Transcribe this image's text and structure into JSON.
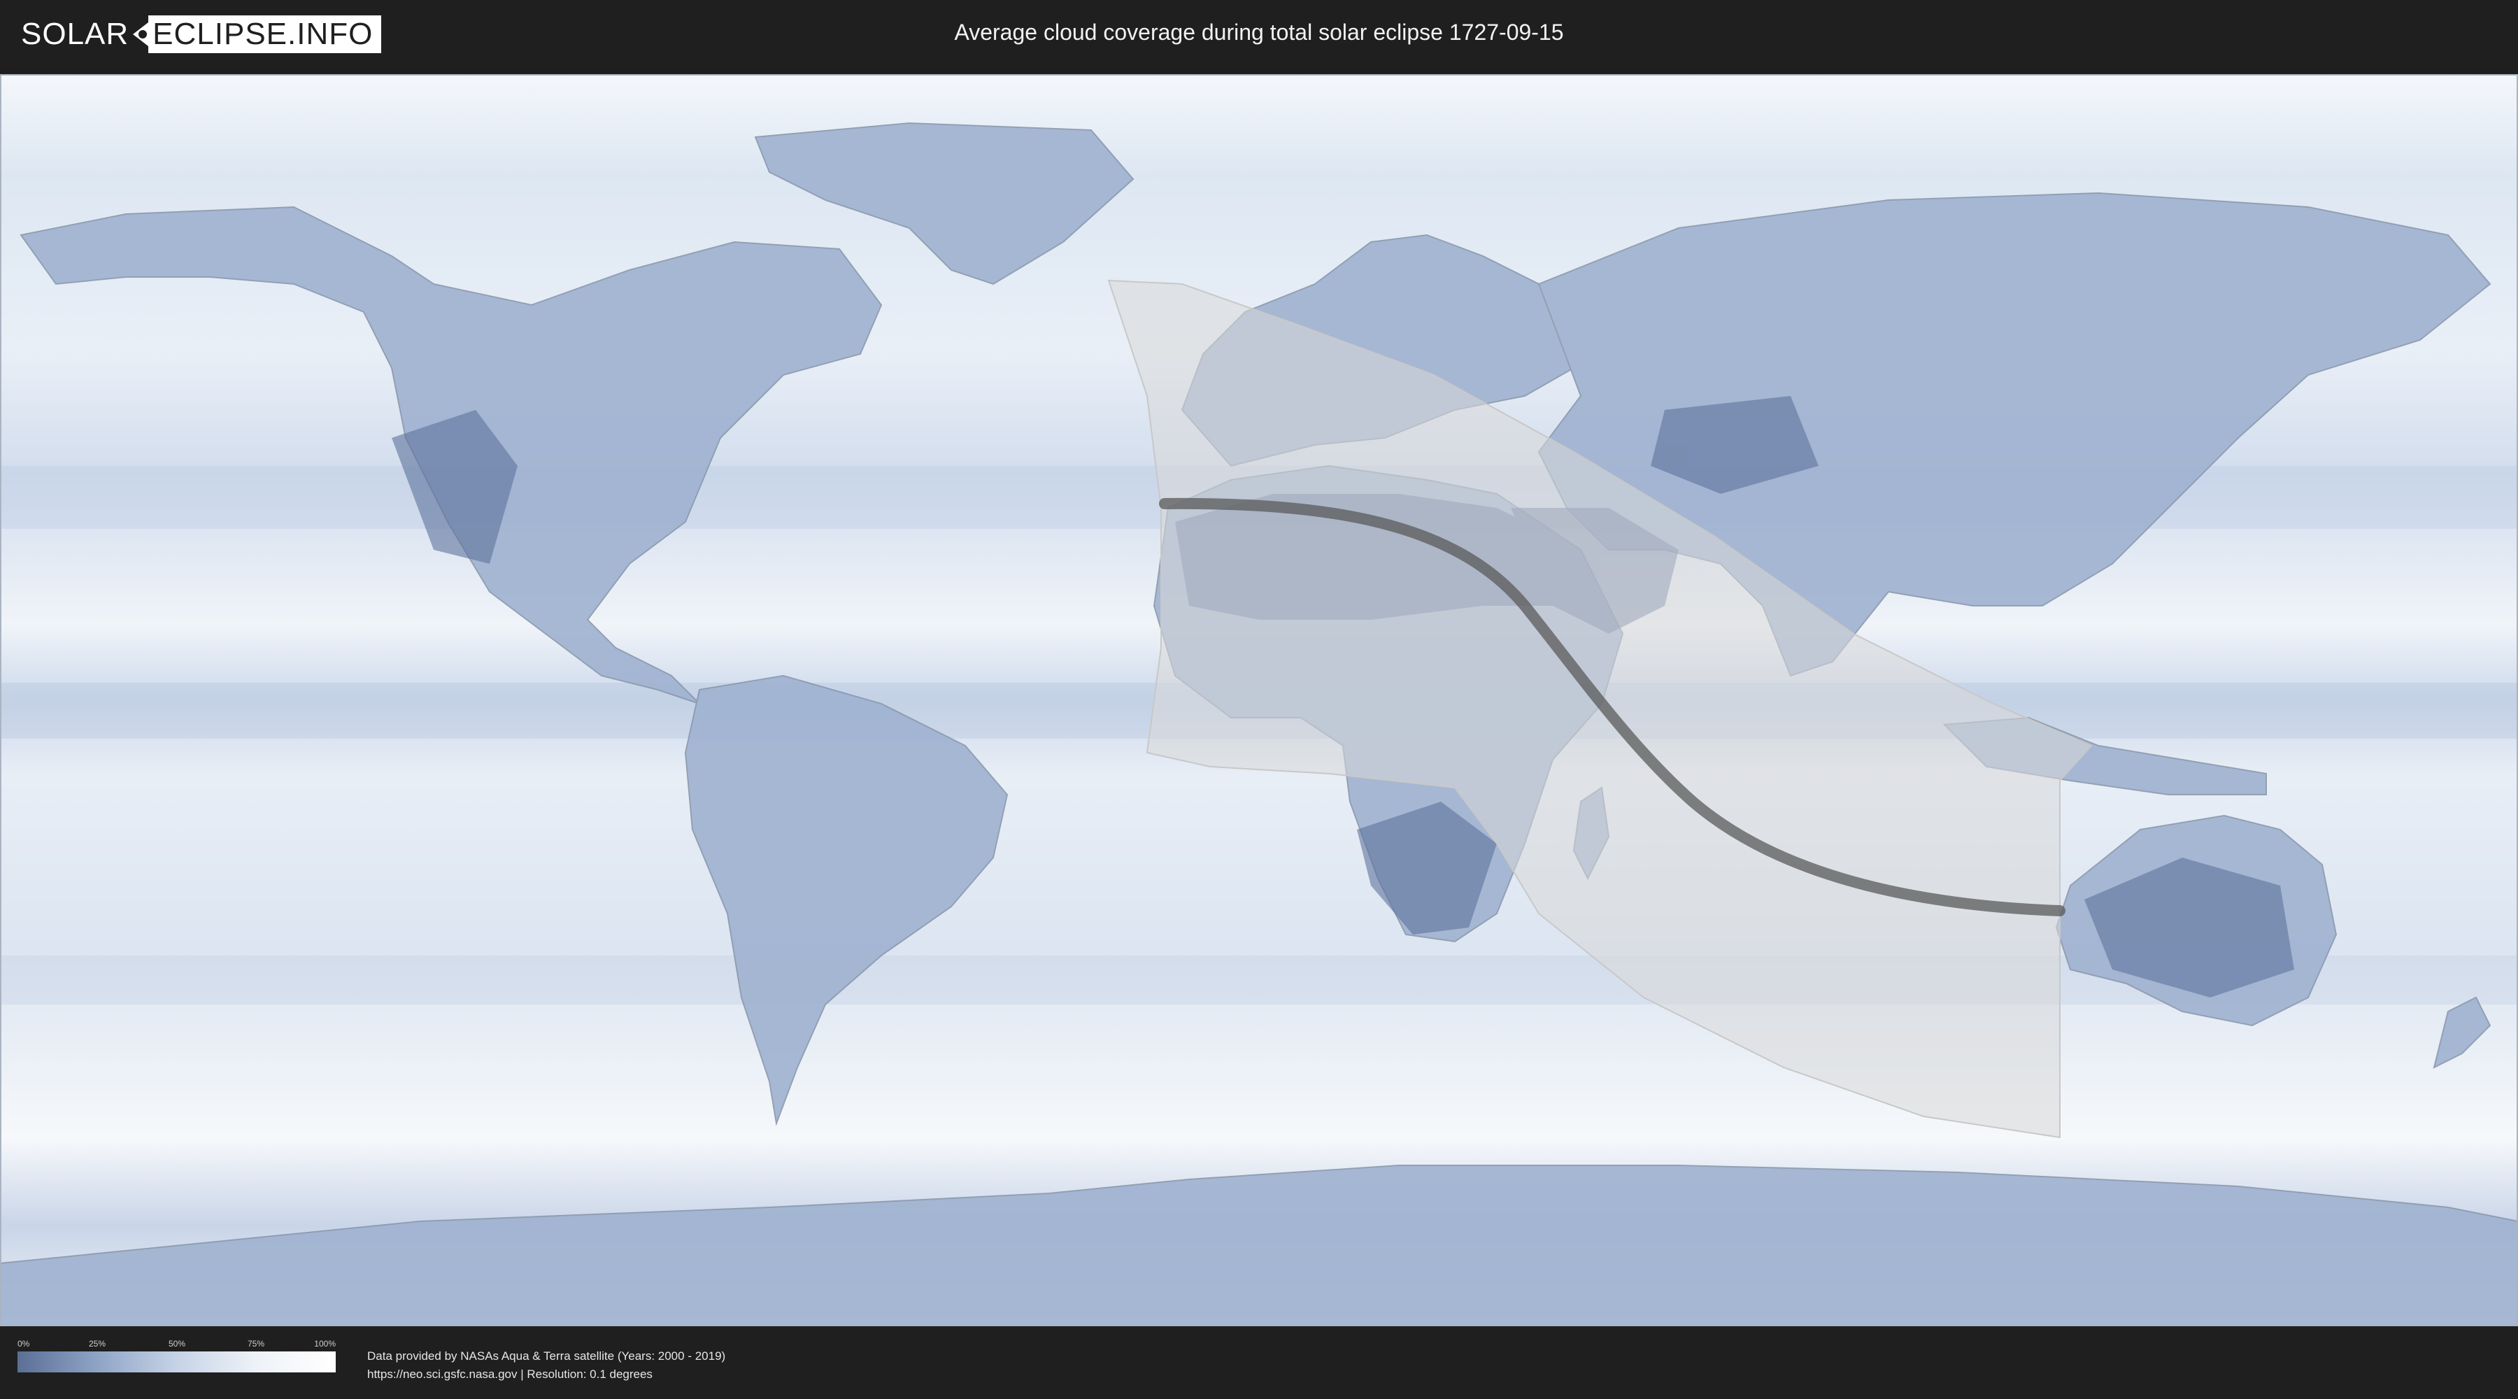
{
  "header": {
    "logo_part1": "SOLAR",
    "logo_part2": "ECLIPSE.INFO",
    "title": "Average cloud coverage during total solar eclipse 1727-09-15"
  },
  "legend": {
    "ticks": [
      "0%",
      "25%",
      "50%",
      "75%",
      "100%"
    ],
    "gradient_colors": [
      "#5b6f96",
      "#8ea4c6",
      "#c6d3e6",
      "#eef2f8",
      "#ffffff"
    ]
  },
  "credits": {
    "line1": "Data provided by NASAs Aqua & Terra satellite (Years: 2000 - 2019)",
    "line2": "https://neo.sci.gsfc.nasa.gov | Resolution: 0.1 degrees"
  },
  "colors": {
    "ocean_cloud": "#e3ebf5",
    "land_clear": "#6f85ab",
    "eclipse_overlay": "#d9d9d9",
    "eclipse_path": "#555555"
  }
}
